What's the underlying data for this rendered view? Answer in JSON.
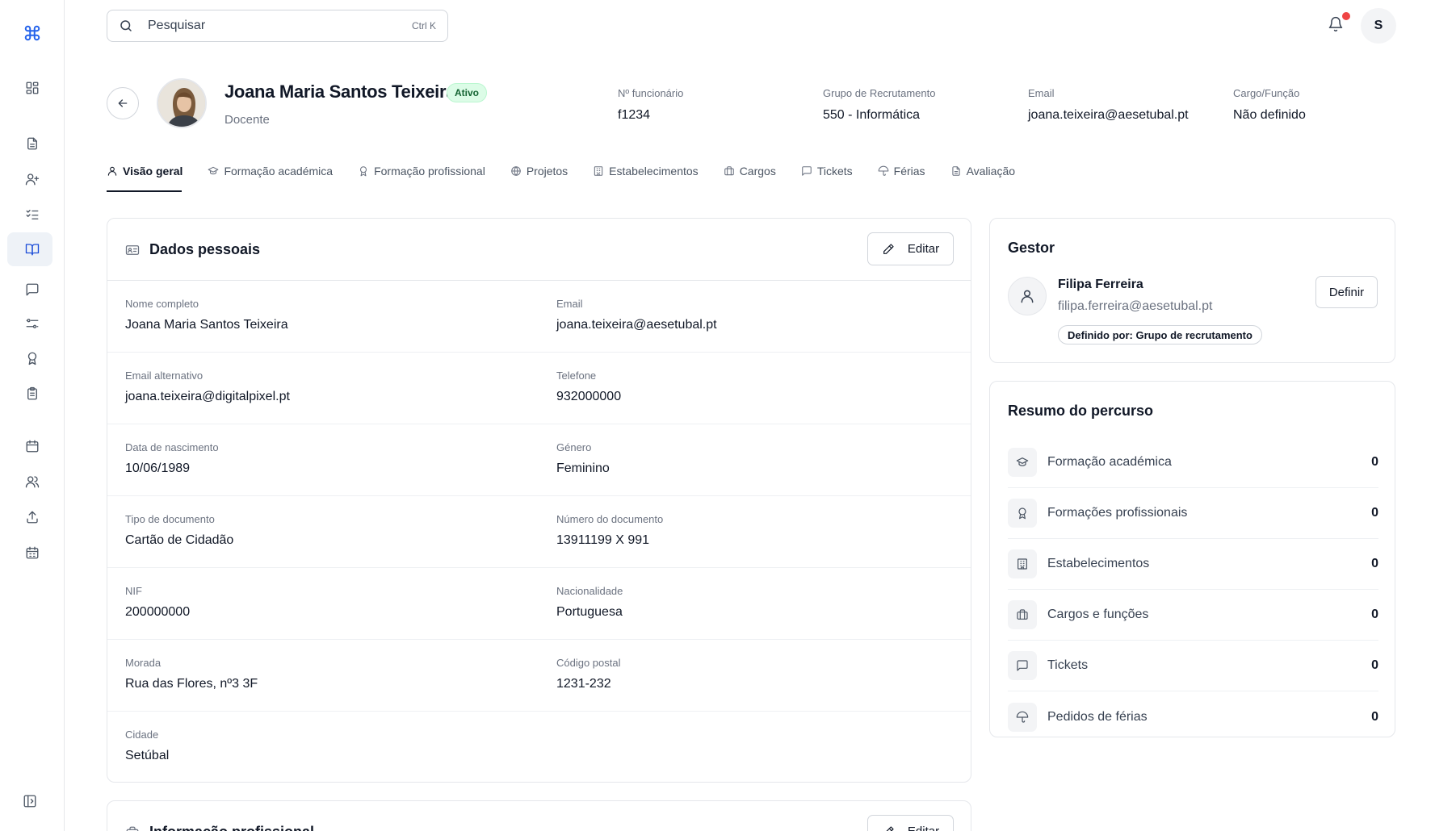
{
  "search": {
    "placeholder": "Pesquisar",
    "shortcut": "Ctrl K"
  },
  "topbar": {
    "avatar_initial": "S"
  },
  "profile": {
    "name": "Joana Maria Santos Teixeira",
    "status": "Ativo",
    "role": "Docente",
    "fields": [
      {
        "label": "Nº funcionário",
        "value": "f1234"
      },
      {
        "label": "Grupo de Recrutamento",
        "value": "550 - Informática"
      },
      {
        "label": "Email",
        "value": "joana.teixeira@aesetubal.pt"
      },
      {
        "label": "Cargo/Função",
        "value": "Não definido"
      }
    ]
  },
  "tabs": [
    {
      "label": "Visão geral",
      "icon": "user-icon"
    },
    {
      "label": "Formação académica",
      "icon": "graduation-cap-icon"
    },
    {
      "label": "Formação profissional",
      "icon": "award-icon"
    },
    {
      "label": "Projetos",
      "icon": "globe-icon"
    },
    {
      "label": "Estabelecimentos",
      "icon": "building-icon"
    },
    {
      "label": "Cargos",
      "icon": "briefcase-icon"
    },
    {
      "label": "Tickets",
      "icon": "message-icon"
    },
    {
      "label": "Férias",
      "icon": "umbrella-icon"
    },
    {
      "label": "Avaliação",
      "icon": "document-icon"
    }
  ],
  "dados": {
    "title": "Dados pessoais",
    "edit_label": "Editar",
    "rows": [
      [
        {
          "label": "Nome completo",
          "value": "Joana Maria Santos Teixeira"
        },
        {
          "label": "Email",
          "value": "joana.teixeira@aesetubal.pt"
        }
      ],
      [
        {
          "label": "Email alternativo",
          "value": "joana.teixeira@digitalpixel.pt"
        },
        {
          "label": "Telefone",
          "value": "932000000"
        }
      ],
      [
        {
          "label": "Data de nascimento",
          "value": "10/06/1989"
        },
        {
          "label": "Género",
          "value": "Feminino"
        }
      ],
      [
        {
          "label": "Tipo de documento",
          "value": "Cartão de Cidadão"
        },
        {
          "label": "Número do documento",
          "value": "13911199 X 991"
        }
      ],
      [
        {
          "label": "NIF",
          "value": "200000000"
        },
        {
          "label": "Nacionalidade",
          "value": "Portuguesa"
        }
      ],
      [
        {
          "label": "Morada",
          "value": "Rua das Flores, nº3 3F"
        },
        {
          "label": "Código postal",
          "value": "1231-232"
        }
      ],
      [
        {
          "label": "Cidade",
          "value": "Setúbal"
        }
      ]
    ]
  },
  "gestor": {
    "title": "Gestor",
    "name": "Filipa Ferreira",
    "email": "filipa.ferreira@aesetubal.pt",
    "defined_by": "Definido por: Grupo de recrutamento",
    "button_label": "Definir"
  },
  "resumo": {
    "title": "Resumo do percurso",
    "items": [
      {
        "label": "Formação académica",
        "count": "0",
        "icon": "graduation-cap-icon"
      },
      {
        "label": "Formações profissionais",
        "count": "0",
        "icon": "award-icon"
      },
      {
        "label": "Estabelecimentos",
        "count": "0",
        "icon": "building-icon"
      },
      {
        "label": "Cargos e funções",
        "count": "0",
        "icon": "briefcase-icon"
      },
      {
        "label": "Tickets",
        "count": "0",
        "icon": "message-icon"
      },
      {
        "label": "Pedidos de férias",
        "count": "0",
        "icon": "umbrella-icon"
      }
    ]
  },
  "info_prof": {
    "title": "Informação profissional",
    "edit_label": "Editar"
  },
  "colors": {
    "accent": "#2563eb",
    "status_active_bg": "#dcfce7",
    "status_active_text": "#166534",
    "notification": "#ef4444"
  }
}
